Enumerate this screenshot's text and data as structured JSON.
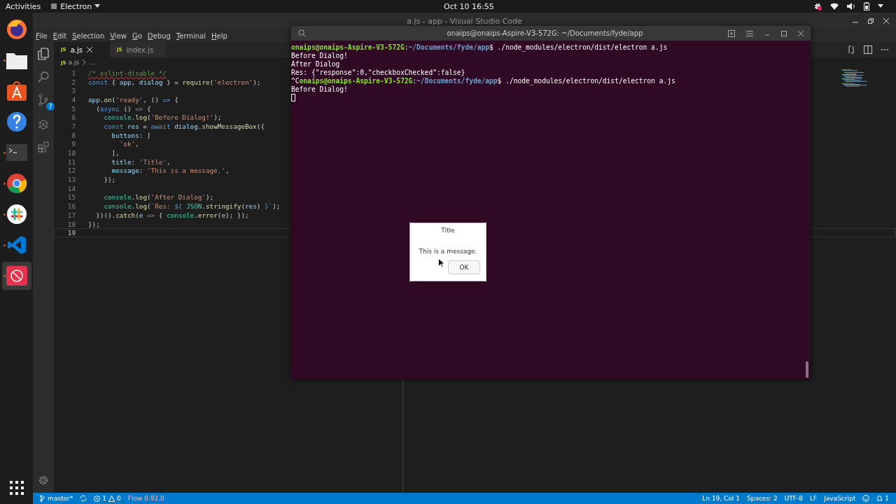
{
  "top_bar": {
    "activities": "Activities",
    "app_menu": "Electron",
    "clock": "Oct 10  16:55"
  },
  "dock": [
    {
      "kind": "firefox",
      "running": false,
      "selected": false
    },
    {
      "kind": "files",
      "running": true,
      "selected": false
    },
    {
      "kind": "software",
      "running": false,
      "selected": false
    },
    {
      "kind": "help",
      "running": false,
      "selected": false
    },
    {
      "kind": "terminal",
      "running": true,
      "selected": false
    },
    {
      "kind": "chrome",
      "running": true,
      "selected": false
    },
    {
      "kind": "slack",
      "running": true,
      "selected": false
    },
    {
      "kind": "vscode",
      "running": true,
      "selected": false
    },
    {
      "kind": "blocked",
      "running": true,
      "selected": true
    }
  ],
  "vscode": {
    "title": "a.js - app - Visual Studio Code",
    "menu": [
      "File",
      "Edit",
      "Selection",
      "View",
      "Go",
      "Debug",
      "Terminal",
      "Help"
    ],
    "scm_badge": "7",
    "tabs": [
      {
        "icon": "JS",
        "label": "a.js",
        "selected": true
      },
      {
        "icon": "JS",
        "label": "index.js",
        "selected": false
      }
    ],
    "breadcrumb": {
      "icon": "JS",
      "file": "a.js",
      "rest": "..."
    },
    "code_lines": [
      {
        "number": "1",
        "current": false,
        "tokens": [
          {
            "kind": "comment",
            "text": "/* eslint-disable */",
            "error": true
          }
        ]
      },
      {
        "number": "2",
        "current": false,
        "tokens": [
          {
            "kind": "keyword",
            "text": "const"
          },
          {
            "kind": "plain",
            "text": " { "
          },
          {
            "kind": "var",
            "text": "app"
          },
          {
            "kind": "plain",
            "text": ", "
          },
          {
            "kind": "var",
            "text": "dialog"
          },
          {
            "kind": "plain",
            "text": " } = "
          },
          {
            "kind": "func",
            "text": "require"
          },
          {
            "kind": "plain",
            "text": "("
          },
          {
            "kind": "string",
            "text": "'electron'"
          },
          {
            "kind": "plain",
            "text": ");"
          }
        ]
      },
      {
        "number": "3",
        "current": false
      },
      {
        "number": "4",
        "current": false,
        "tokens": [
          {
            "kind": "var",
            "text": "app"
          },
          {
            "kind": "plain",
            "text": "."
          },
          {
            "kind": "func",
            "text": "on"
          },
          {
            "kind": "plain",
            "text": "("
          },
          {
            "kind": "string",
            "text": "'ready'"
          },
          {
            "kind": "plain",
            "text": ", () "
          },
          {
            "kind": "keyword",
            "text": "=>"
          },
          {
            "kind": "plain",
            "text": " {"
          }
        ]
      },
      {
        "number": "5",
        "current": false,
        "tokens": [
          {
            "kind": "plain",
            "text": "  ("
          },
          {
            "kind": "keyword",
            "text": "async"
          },
          {
            "kind": "plain",
            "text": " () "
          },
          {
            "kind": "keyword",
            "text": "=>"
          },
          {
            "kind": "plain",
            "text": " {"
          }
        ]
      },
      {
        "number": "6",
        "current": false,
        "tokens": [
          {
            "kind": "class",
            "text": "    console"
          },
          {
            "kind": "plain",
            "text": "."
          },
          {
            "kind": "func",
            "text": "log"
          },
          {
            "kind": "plain",
            "text": "("
          },
          {
            "kind": "string",
            "text": "'Before Dialog!'"
          },
          {
            "kind": "plain",
            "text": ");"
          }
        ]
      },
      {
        "number": "7",
        "current": false,
        "tokens": [
          {
            "kind": "keyword",
            "text": "    const"
          },
          {
            "kind": "var",
            "text": " res"
          },
          {
            "kind": "plain",
            "text": " = "
          },
          {
            "kind": "keyword",
            "text": "await"
          },
          {
            "kind": "var",
            "text": " dialog"
          },
          {
            "kind": "plain",
            "text": "."
          },
          {
            "kind": "func",
            "text": "showMessageBox"
          },
          {
            "kind": "plain",
            "text": "({"
          }
        ]
      },
      {
        "number": "8",
        "current": false,
        "tokens": [
          {
            "kind": "var",
            "text": "      buttons"
          },
          {
            "kind": "plain",
            "text": ": ["
          }
        ]
      },
      {
        "number": "9",
        "current": false,
        "tokens": [
          {
            "kind": "string",
            "text": "        'ok'"
          },
          {
            "kind": "plain",
            "text": ","
          }
        ]
      },
      {
        "number": "10",
        "current": false,
        "tokens": [
          {
            "kind": "plain",
            "text": "      ],"
          }
        ]
      },
      {
        "number": "11",
        "current": false,
        "tokens": [
          {
            "kind": "var",
            "text": "      title"
          },
          {
            "kind": "plain",
            "text": ": "
          },
          {
            "kind": "string",
            "text": "'Title'"
          },
          {
            "kind": "plain",
            "text": ","
          }
        ]
      },
      {
        "number": "12",
        "current": false,
        "tokens": [
          {
            "kind": "var",
            "text": "      message"
          },
          {
            "kind": "plain",
            "text": ": "
          },
          {
            "kind": "string",
            "text": "'This is a message.'"
          },
          {
            "kind": "plain",
            "text": ","
          }
        ]
      },
      {
        "number": "13",
        "current": false,
        "tokens": [
          {
            "kind": "plain",
            "text": "    });"
          }
        ]
      },
      {
        "number": "14",
        "current": false
      },
      {
        "number": "15",
        "current": false,
        "tokens": [
          {
            "kind": "class",
            "text": "    console"
          },
          {
            "kind": "plain",
            "text": "."
          },
          {
            "kind": "func",
            "text": "log"
          },
          {
            "kind": "plain",
            "text": "("
          },
          {
            "kind": "string",
            "text": "'After Dialog'"
          },
          {
            "kind": "plain",
            "text": ");"
          }
        ]
      },
      {
        "number": "16",
        "current": false,
        "tokens": [
          {
            "kind": "class",
            "text": "    console"
          },
          {
            "kind": "plain",
            "text": "."
          },
          {
            "kind": "func",
            "text": "log"
          },
          {
            "kind": "plain",
            "text": "("
          },
          {
            "kind": "string",
            "text": "`Res: "
          },
          {
            "kind": "keyword",
            "text": "${"
          },
          {
            "kind": "class",
            "text": " JSON"
          },
          {
            "kind": "plain",
            "text": "."
          },
          {
            "kind": "func",
            "text": "stringify"
          },
          {
            "kind": "plain",
            "text": "("
          },
          {
            "kind": "var",
            "text": "res"
          },
          {
            "kind": "plain",
            "text": ") "
          },
          {
            "kind": "keyword",
            "text": "}"
          },
          {
            "kind": "string",
            "text": "`"
          },
          {
            "kind": "plain",
            "text": ");"
          }
        ]
      },
      {
        "number": "17",
        "current": false,
        "tokens": [
          {
            "kind": "plain",
            "text": "  })()."
          },
          {
            "kind": "func",
            "text": "catch"
          },
          {
            "kind": "plain",
            "text": "("
          },
          {
            "kind": "var",
            "text": "e"
          },
          {
            "kind": "keyword",
            "text": " =>"
          },
          {
            "kind": "plain",
            "text": " { "
          },
          {
            "kind": "class",
            "text": "console"
          },
          {
            "kind": "plain",
            "text": "."
          },
          {
            "kind": "func",
            "text": "error"
          },
          {
            "kind": "plain",
            "text": "("
          },
          {
            "kind": "var",
            "text": "e"
          },
          {
            "kind": "plain",
            "text": "); });"
          }
        ]
      },
      {
        "number": "18",
        "current": false,
        "tokens": [
          {
            "kind": "plain",
            "text": "});"
          }
        ]
      },
      {
        "number": "19",
        "current": true
      }
    ],
    "status_bar": {
      "branch": "master*",
      "errors": "1",
      "warnings": "0",
      "flow": "Flow 0.92.0",
      "right": [
        "Ln 19, Col 1",
        "Spaces: 2",
        "UTF-8",
        "LF",
        "JavaScript"
      ],
      "notifications": "1"
    }
  },
  "terminal": {
    "title": "onaips@onaips-Aspire-V3-572G: ~/Documents/fyde/app",
    "lines": [
      [
        {
          "kind": "user",
          "text": "onaips@onaips-Aspire-V3-572G"
        },
        {
          "kind": "plain",
          "text": ":"
        },
        {
          "kind": "path",
          "text": "~/Documents/fyde/app"
        },
        {
          "kind": "plain",
          "text": "$ ./node_modules/electron/dist/electron a.js"
        }
      ],
      [
        {
          "kind": "plain",
          "text": "Before Dialog!"
        }
      ],
      [
        {
          "kind": "plain",
          "text": "After Dialog"
        }
      ],
      [
        {
          "kind": "plain",
          "text": "Res: {\"response\":0,\"checkboxChecked\":false}"
        }
      ],
      [
        {
          "kind": "plain",
          "text": "^C"
        },
        {
          "kind": "user",
          "text": "onaips@onaips-Aspire-V3-572G"
        },
        {
          "kind": "plain",
          "text": ":"
        },
        {
          "kind": "path",
          "text": "~/Documents/fyde/app"
        },
        {
          "kind": "plain",
          "text": "$ ./node_modules/electron/dist/electron a.js"
        }
      ],
      [
        {
          "kind": "plain",
          "text": "Before Dialog!"
        }
      ]
    ]
  },
  "dialog": {
    "title": "Title",
    "message": "This is a message.",
    "buttons": [
      "OK"
    ]
  }
}
